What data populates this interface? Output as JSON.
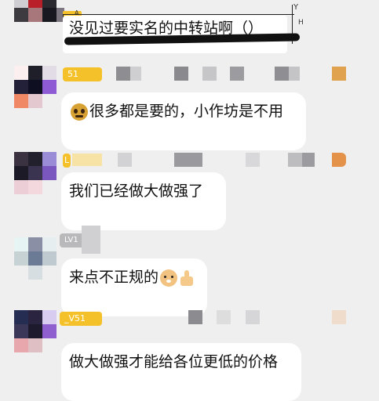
{
  "top": {
    "quote_text": "没见过要实名的中转站啊（）",
    "marker_a": "A",
    "marker_y": "Y",
    "marker_h": "H"
  },
  "messages": [
    {
      "level": "51",
      "text": "很多都是要的，小作坊是不用",
      "emoji_left": "pleading-face"
    },
    {
      "level": "L",
      "text": "我们已经做大做强了"
    },
    {
      "level": "LV1",
      "text": "来点不正规的",
      "emoji_right": [
        "dog-face",
        "thumbs-up"
      ]
    },
    {
      "level": "_V51",
      "text": "做大做强才能给各位更低的价格"
    }
  ],
  "colors": {
    "background": "#efeff0",
    "bubble": "#ffffff",
    "badge_gold": "#f5c12a",
    "badge_gray": "#b9b9bb"
  }
}
